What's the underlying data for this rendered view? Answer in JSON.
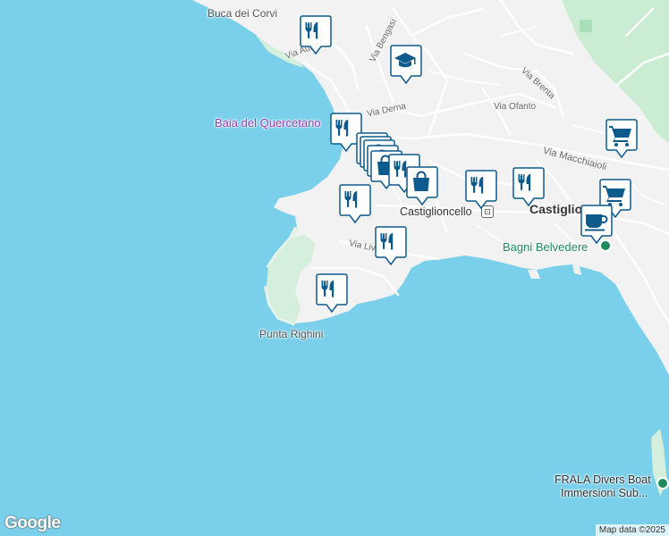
{
  "places": {
    "buca_dei_corvi": "Buca dei Corvi",
    "baia_del_quercetano": "Baia del Quercetano",
    "castiglioncello_station": "Castiglioncello",
    "castiglio": "Castiglio",
    "bagni_belvedere": "Bagni Belvedere",
    "punta_righini": "Punta Righini",
    "frala_line1": "FRALA Divers Boat",
    "frala_line2": "Immersioni Sub..."
  },
  "roads": {
    "via_aurelia": "Via Aurelia",
    "via_bengasi": "Via Bengasi",
    "via_derna": "Via Derna",
    "via_brenta": "Via Brenta",
    "via_ofanto": "Via Ofanto",
    "via_macchiaioli": "Via Macchiaioli",
    "via_liv": "Via Liv"
  },
  "colors": {
    "water": "#7ad0ea",
    "land": "#f2f2f2",
    "park": "#c9ecd2",
    "marker": "#0d5a8c",
    "poi_purple": "#9b3fb5",
    "poi_green": "#1f8a5b"
  },
  "markers": [
    {
      "type": "restaurant",
      "icon": "fork-knife-icon"
    },
    {
      "type": "school",
      "icon": "graduation-cap-icon"
    },
    {
      "type": "restaurant",
      "icon": "fork-knife-icon"
    },
    {
      "type": "shopping",
      "icon": "shopping-bag-icon"
    },
    {
      "type": "restaurant",
      "icon": "fork-knife-icon"
    },
    {
      "type": "shopping",
      "icon": "shopping-bag-icon"
    },
    {
      "type": "restaurant",
      "icon": "fork-knife-icon"
    },
    {
      "type": "restaurant",
      "icon": "fork-knife-icon"
    },
    {
      "type": "restaurant",
      "icon": "fork-knife-icon"
    },
    {
      "type": "restaurant",
      "icon": "fork-knife-icon"
    },
    {
      "type": "restaurant",
      "icon": "fork-knife-icon"
    },
    {
      "type": "grocery",
      "icon": "shopping-cart-icon"
    },
    {
      "type": "grocery",
      "icon": "shopping-cart-icon"
    },
    {
      "type": "cafe",
      "icon": "coffee-cup-icon"
    }
  ],
  "attribution": "Map data ©2025",
  "logo": "Google"
}
